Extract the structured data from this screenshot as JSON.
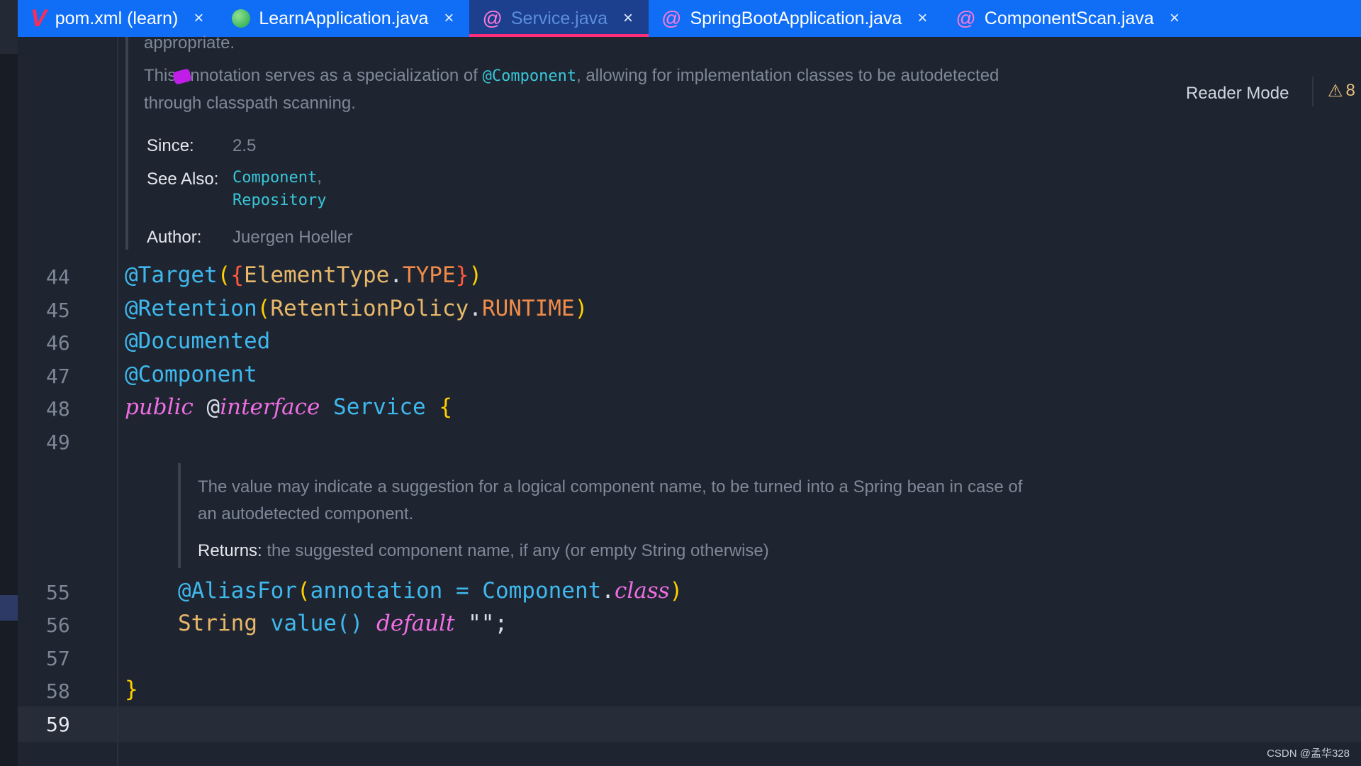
{
  "tabs": [
    {
      "label": "pom.xml (learn)",
      "icon": "maven-v-icon",
      "close": "×",
      "active": false
    },
    {
      "label": "LearnApplication.java",
      "icon": "spring-app-icon",
      "close": "×",
      "active": false
    },
    {
      "label": "Service.java",
      "icon": "annotation-at-icon",
      "close": "×",
      "active": true
    },
    {
      "label": "SpringBootApplication.java",
      "icon": "annotation-at-icon",
      "close": "×",
      "active": false
    },
    {
      "label": "ComponentScan.java",
      "icon": "annotation-at-icon",
      "close": "×",
      "active": false
    }
  ],
  "reader_mode": "Reader Mode",
  "warnings": {
    "icon": "⚠",
    "count": "8"
  },
  "class_doc": {
    "cut_line": "appropriate.",
    "para_pre": "This annotation serves as a specialization of ",
    "para_ref": "@Component",
    "para_post_1": ", allowing for implementation classes to be autodetected",
    "para_post_2": "through classpath scanning.",
    "since_label": "Since:",
    "since_value": "2.5",
    "see_also_label": "See Also:",
    "see_also": [
      "Component",
      "Repository"
    ],
    "see_also_sep": ",",
    "author_label": "Author:",
    "author_value": "Juergen Hoeller"
  },
  "method_doc": {
    "line1": "The value may indicate a suggestion for a logical component name, to be turned into a Spring bean in case of",
    "line2": "an autodetected component.",
    "returns_label": "Returns:",
    "returns_value": "the suggested component name, if any (or empty String otherwise)"
  },
  "line_numbers": [
    "44",
    "45",
    "46",
    "47",
    "48",
    "49",
    "55",
    "56",
    "57",
    "58",
    "59"
  ],
  "code": {
    "l44": {
      "ann": "@Target",
      "p1": "(",
      "b1": "{",
      "t": "ElementType",
      "dot": ".",
      "c": "TYPE",
      "b2": "}",
      "p2": ")"
    },
    "l45": {
      "ann": "@Retention",
      "p1": "(",
      "t": "RetentionPolicy",
      "dot": ".",
      "c": "RUNTIME",
      "p2": ")"
    },
    "l46": {
      "ann": "@Documented"
    },
    "l47": {
      "ann": "@Component"
    },
    "l48": {
      "kw1": "public",
      "at": "@",
      "kw2": "interface",
      "name": "Service",
      "brace": "{"
    },
    "l55": {
      "ann": "@AliasFor",
      "p1": "(",
      "attr": "annotation",
      "eq": " = ",
      "cls": "Component",
      "dot": ".",
      "kw": "class",
      "p2": ")"
    },
    "l56": {
      "type": "String",
      "method": "value()",
      "kw": "default",
      "str": "\"\"",
      "semi": ";"
    },
    "l58": {
      "brace": "}"
    }
  },
  "watermark": "CSDN @孟华328"
}
